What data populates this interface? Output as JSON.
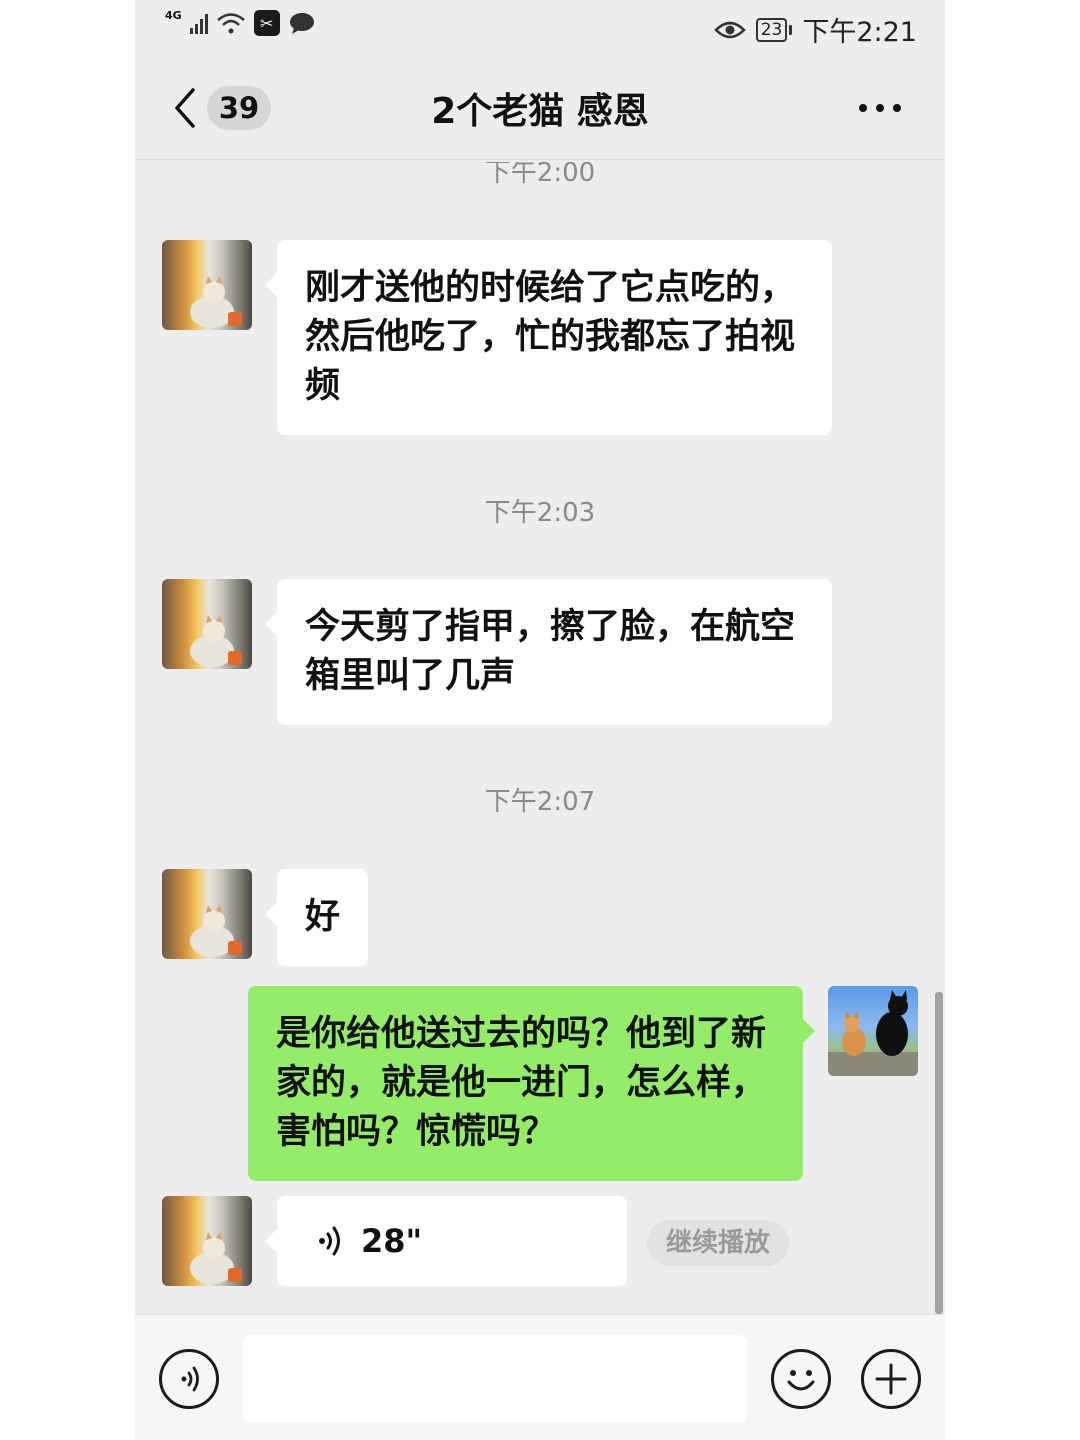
{
  "status_bar": {
    "network": "4G",
    "battery": "23",
    "time": "下午2:21",
    "icons": [
      "signal-icon",
      "wifi-icon",
      "capcut-icon",
      "message-icon",
      "eye-icon",
      "battery-icon"
    ]
  },
  "header": {
    "unread_count": "39",
    "title": "2个老猫 感恩"
  },
  "chat": {
    "timestamps": [
      "下午2:00",
      "下午2:03",
      "下午2:07"
    ],
    "messages": [
      {
        "from": "other",
        "text": "刚才送他的时候给了它点吃的，然后他吃了，忙的我都忘了拍视频"
      },
      {
        "from": "other",
        "text": "今天剪了指甲，擦了脸，在航空箱里叫了几声"
      },
      {
        "from": "other",
        "text": "好"
      },
      {
        "from": "self",
        "text": "是你给他送过去的吗？他到了新家的，就是他一进门，怎么样，害怕吗？惊慌吗？"
      }
    ],
    "voice_message": {
      "duration": "28\"",
      "resume_label": "继续播放"
    }
  },
  "input_bar": {
    "icons": [
      "voice-input-icon",
      "emoji-icon",
      "plus-icon"
    ]
  },
  "colors": {
    "chat_background": "#ededed",
    "self_bubble": "#95ec69",
    "other_bubble": "#ffffff"
  }
}
